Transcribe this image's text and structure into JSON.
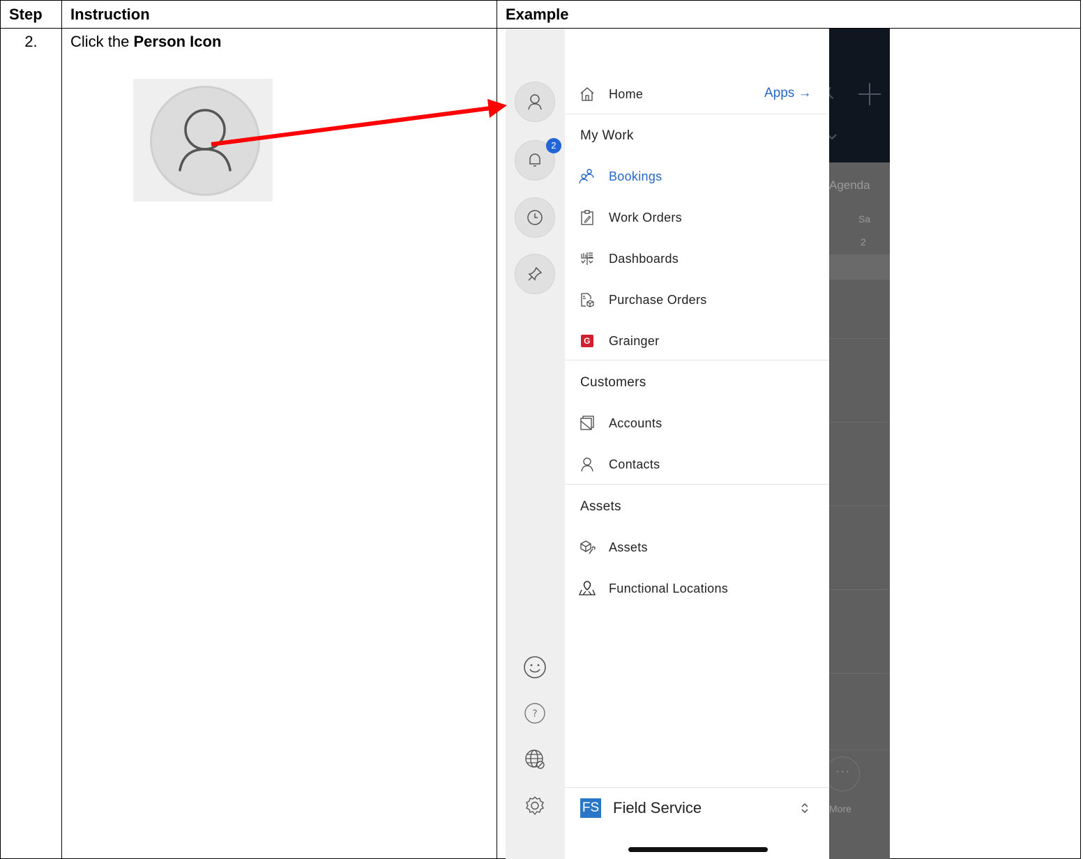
{
  "table": {
    "headers": {
      "step": "Step",
      "instruction": "Instruction",
      "example": "Example"
    },
    "row": {
      "step": "2.",
      "instruction_prefix": "Click the ",
      "instruction_bold": "Person Icon"
    }
  },
  "app": {
    "rail": {
      "notification_count": "2",
      "top_icons": [
        "person-icon",
        "bell-icon",
        "clock-icon",
        "pin-icon"
      ],
      "bottom_icons": [
        "smiley-icon",
        "help-icon",
        "globe-icon",
        "settings-icon"
      ]
    },
    "nav": {
      "home": "Home",
      "apps_link": "Apps →",
      "sections": [
        {
          "title": "My Work",
          "items": [
            {
              "label": "Bookings",
              "icon": "bookings-icon",
              "active": true
            },
            {
              "label": "Work Orders",
              "icon": "clipboard-icon"
            },
            {
              "label": "Dashboards",
              "icon": "dashboard-icon"
            },
            {
              "label": "Purchase Orders",
              "icon": "purchase-order-icon"
            },
            {
              "label": "Grainger",
              "icon": "grainger-logo-icon"
            }
          ]
        },
        {
          "title": "Customers",
          "items": [
            {
              "label": "Accounts",
              "icon": "accounts-icon"
            },
            {
              "label": "Contacts",
              "icon": "person-icon"
            }
          ]
        },
        {
          "title": "Assets",
          "items": [
            {
              "label": "Assets",
              "icon": "asset-box-icon"
            },
            {
              "label": "Functional Locations",
              "icon": "location-pin-icon"
            }
          ]
        }
      ]
    },
    "footer": {
      "app_abbrev": "FS",
      "app_name": "Field Service"
    },
    "background": {
      "tab_label": "Agenda",
      "day_label": "Sa",
      "day_number": "2",
      "more_label": "More"
    },
    "colors": {
      "accent": "#2667c9",
      "grainger": "#d0202f",
      "arrow": "#ff0000",
      "tile": "#2b77c7"
    }
  }
}
